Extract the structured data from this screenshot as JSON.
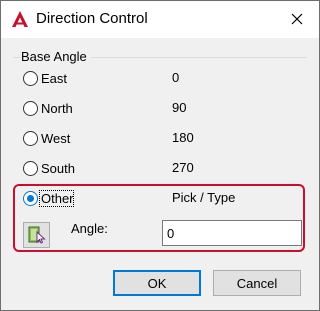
{
  "window": {
    "title": "Direction Control",
    "app_icon": "autocad-icon",
    "close_icon": "close-icon"
  },
  "base_angle": {
    "group_label": "Base Angle",
    "options": [
      {
        "label": "East",
        "value": "0",
        "checked": false
      },
      {
        "label": "North",
        "value": "90",
        "checked": false
      },
      {
        "label": "West",
        "value": "180",
        "checked": false
      },
      {
        "label": "South",
        "value": "270",
        "checked": false
      },
      {
        "label": "Other",
        "value": "Pick / Type",
        "checked": true
      }
    ]
  },
  "angle": {
    "label": "Angle:",
    "value": "0",
    "pick_icon": "pick-angle-icon"
  },
  "buttons": {
    "ok": "OK",
    "cancel": "Cancel"
  },
  "colors": {
    "highlight_box": "#c8102e",
    "accent": "#0078d7"
  }
}
